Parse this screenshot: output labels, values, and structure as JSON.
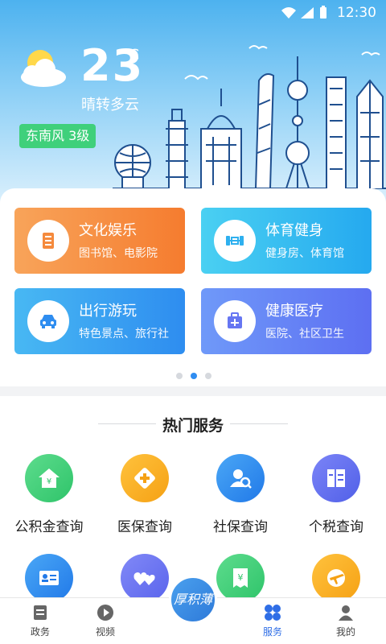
{
  "status_bar": {
    "time": "12:30"
  },
  "weather": {
    "temperature": "23",
    "unit": "℃",
    "condition": "晴转多云",
    "wind": "东南风 3级"
  },
  "categories": [
    {
      "title": "文化娱乐",
      "subtitle": "图书馆、电影院",
      "icon": "library-icon"
    },
    {
      "title": "体育健身",
      "subtitle": "健身房、体育馆",
      "icon": "dumbbell-icon"
    },
    {
      "title": "出行游玩",
      "subtitle": "特色景点、旅行社",
      "icon": "car-icon"
    },
    {
      "title": "健康医疗",
      "subtitle": "医院、社区卫生",
      "icon": "medical-kit-icon"
    }
  ],
  "carousel": {
    "page_count": 3,
    "active_index": 1
  },
  "hot_services": {
    "title": "热门服务",
    "items": [
      {
        "label": "公积金查询",
        "icon": "housing-fund-icon",
        "color": "#3ecf74"
      },
      {
        "label": "医保查询",
        "icon": "medical-insurance-icon",
        "color": "#f5a623"
      },
      {
        "label": "社保查询",
        "icon": "social-security-icon",
        "color": "#2d8cf0"
      },
      {
        "label": "个税查询",
        "icon": "tax-icon",
        "color": "#5b6cf0"
      },
      {
        "label": "",
        "icon": "id-card-icon",
        "color": "#2d8cf0"
      },
      {
        "label": "",
        "icon": "hearts-icon",
        "color": "#6a73f0"
      },
      {
        "label": "",
        "icon": "receipt-icon",
        "color": "#3ecf74"
      },
      {
        "label": "",
        "icon": "plane-icon",
        "color": "#f5a623"
      }
    ]
  },
  "tabbar": {
    "tabs": [
      {
        "label": "政务",
        "icon": "document-icon"
      },
      {
        "label": "视频",
        "icon": "play-icon"
      },
      {
        "label": "服务",
        "icon": "grid-icon",
        "active": true
      },
      {
        "label": "我的",
        "icon": "person-icon"
      }
    ],
    "center_label": "厚积薄发"
  }
}
